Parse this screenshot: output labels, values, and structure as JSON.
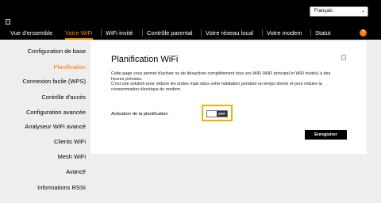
{
  "header": {
    "language": "Français"
  },
  "nav": {
    "items": [
      {
        "label": "Vue d'ensemble"
      },
      {
        "label": "Votre WiFi"
      },
      {
        "label": "WiFi invité"
      },
      {
        "label": "Contrôle parental"
      },
      {
        "label": "Votre réseau local"
      },
      {
        "label": "Votre modem"
      },
      {
        "label": "Statut"
      }
    ],
    "active_index": 1,
    "help_label": "?"
  },
  "sidebar": {
    "items": [
      {
        "label": "Configuration de base"
      },
      {
        "label": "Planification"
      },
      {
        "label": "Connexion facile (WPS)"
      },
      {
        "label": "Contrôle d'accès"
      },
      {
        "label": "Configuration avancée"
      },
      {
        "label": "Analyseur WiFi avancé"
      },
      {
        "label": "Clients WiFi"
      },
      {
        "label": "Mesh WiFi"
      },
      {
        "label": "Avancé"
      },
      {
        "label": "Informations RSSI"
      }
    ],
    "active_index": 1
  },
  "panel": {
    "title": "Planification WiFi",
    "description_1": "Cette page vous permet d'activer ou de désactiver complètement tous vos WiFi (WiFi principal et WiFi invités) à des heures précises.",
    "description_2": "C'est une solution pour réduire les ondes mais dans votre habitation pendant un temps donné et pour réduire la consommation électrique du modem.",
    "field_label": "Activation de la planification",
    "toggle_state": "OFF",
    "save_label": "Enregistrer"
  },
  "colors": {
    "accent": "#ff7900",
    "focus_outline": "#f3b200",
    "topbar": "#000000"
  }
}
